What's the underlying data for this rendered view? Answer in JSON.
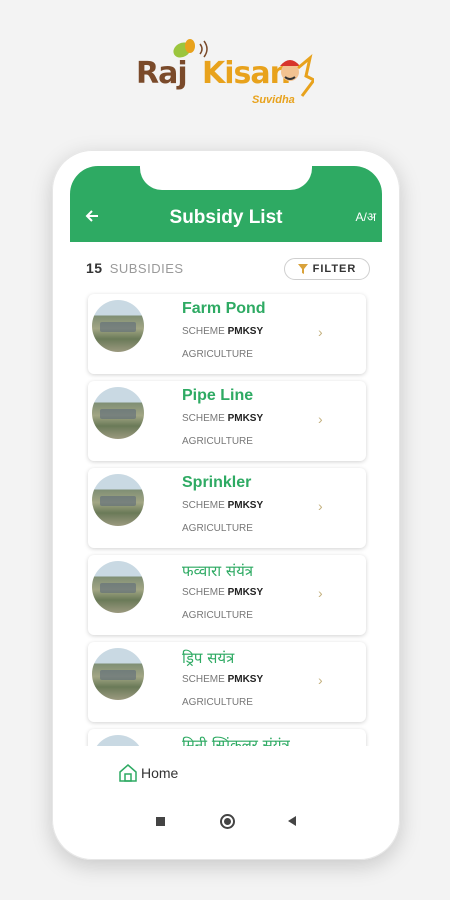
{
  "brand": {
    "part1": "Raj",
    "part2": "Kisan",
    "tagline": "Suvidha"
  },
  "appbar": {
    "title": "Subsidy List",
    "lang_toggle": "A/अ"
  },
  "summary": {
    "count": "15",
    "label": "SUBSIDIES"
  },
  "filter": {
    "label": "FILTER"
  },
  "subsidies": [
    {
      "title": "Farm Pond",
      "scheme_label": "SCHEME",
      "scheme": "PMKSY",
      "category": "AGRICULTURE"
    },
    {
      "title": "Pipe Line",
      "scheme_label": "SCHEME",
      "scheme": "PMKSY",
      "category": "AGRICULTURE"
    },
    {
      "title": "Sprinkler",
      "scheme_label": "SCHEME",
      "scheme": "PMKSY",
      "category": "AGRICULTURE"
    },
    {
      "title": "फव्वारा संयंत्र",
      "scheme_label": "SCHEME",
      "scheme": "PMKSY",
      "category": "AGRICULTURE"
    },
    {
      "title": "ड्रिप सयंत्र",
      "scheme_label": "SCHEME",
      "scheme": "PMKSY",
      "category": "AGRICULTURE"
    },
    {
      "title": "मिनी स्प्रिंकलर संयंत्र",
      "scheme_label": "",
      "scheme": "",
      "category": ""
    }
  ],
  "bottom_nav": {
    "home_label": "Home"
  },
  "colors": {
    "primary": "#2eaa63",
    "brand_brown": "#7a4a2a",
    "brand_orange": "#e8a21c"
  }
}
